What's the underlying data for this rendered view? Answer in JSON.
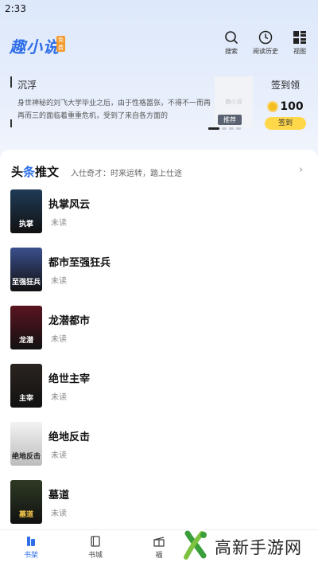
{
  "status_bar": {
    "time": "2:33"
  },
  "header": {
    "logo": "趣小说",
    "logo_badge": "免费",
    "actions": [
      {
        "label": "搜索",
        "icon": "search-icon"
      },
      {
        "label": "阅读历史",
        "icon": "clock-icon"
      },
      {
        "label": "视图",
        "icon": "grid-view-icon"
      }
    ]
  },
  "banner": {
    "title": "沉浮",
    "description": "身世神秘的刘飞大学毕业之后，由于性格嚣张，不得不一而再再而三的面临着重重危机，受到了来自各方面的",
    "image_placeholder": "趣小说",
    "tag": "推荐"
  },
  "signin": {
    "label": "签到领",
    "coins": "100",
    "button": "签到"
  },
  "section": {
    "title_part1": "头",
    "title_em": "条",
    "title_part2": "推文",
    "subtitle": "入仕奇才：时来运转，踏上仕途",
    "arrow": "›"
  },
  "books": [
    {
      "title": "执掌风云",
      "status": "未读",
      "cover_text": "执掌",
      "cover_color": "#1f3b57"
    },
    {
      "title": "都市至强狂兵",
      "status": "未读",
      "cover_text": "至强狂兵",
      "cover_color": "#3a4f8c"
    },
    {
      "title": "龙潜都市",
      "status": "未读",
      "cover_text": "龙潜",
      "cover_color": "#5a1420"
    },
    {
      "title": "绝世主宰",
      "status": "未读",
      "cover_text": "主宰",
      "cover_color": "#2b2420"
    },
    {
      "title": "绝地反击",
      "status": "未读",
      "cover_text": "绝地反击",
      "cover_color": "#d9d9d9"
    },
    {
      "title": "墓道",
      "status": "未读",
      "cover_text": "墓道",
      "cover_color": "#2e3a24"
    }
  ],
  "bottom_nav": [
    {
      "label": "书架",
      "active": true
    },
    {
      "label": "书城",
      "active": false
    },
    {
      "label": "福",
      "active": false
    }
  ],
  "watermark": {
    "text": "高新手游网"
  },
  "colors": {
    "accent": "#2f6fe8",
    "signin_button": "#ffd84a",
    "coin": "#f5bd1f"
  }
}
